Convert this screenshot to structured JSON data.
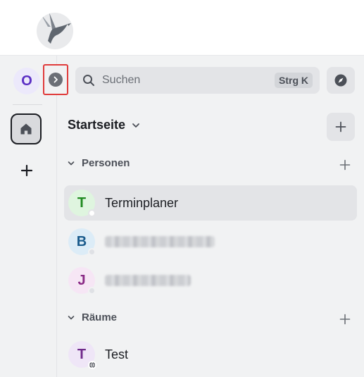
{
  "workspace": {
    "avatar_letter": "O"
  },
  "search": {
    "label": "Suchen",
    "shortcut": "Strg K"
  },
  "home": {
    "title": "Startseite"
  },
  "sections": [
    {
      "label": "Personen",
      "rooms": [
        {
          "initial": "T",
          "name": "Terminplaner",
          "active": true,
          "avatar_bg": "#dff5df",
          "avatar_fg": "#1f8a1f"
        },
        {
          "initial": "B",
          "name": "",
          "avatar_bg": "#dcecf7",
          "avatar_fg": "#1a5b8c"
        },
        {
          "initial": "J",
          "name": "",
          "avatar_bg": "#f6e6f5",
          "avatar_fg": "#8a2a86"
        }
      ]
    },
    {
      "label": "Räume",
      "rooms": [
        {
          "initial": "T",
          "name": "Test",
          "avatar_bg": "#efe6f7",
          "avatar_fg": "#6f2a8a"
        }
      ]
    }
  ],
  "colors": {
    "highlight_border": "#e03b3b",
    "panel_bg": "#f1f2f3",
    "active_row_bg": "#e3e4e7"
  }
}
